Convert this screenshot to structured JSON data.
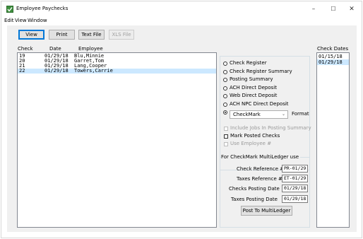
{
  "window": {
    "title": "Employee Paychecks",
    "controls": {
      "minimize": "–",
      "maximize": "☐",
      "close": "✕"
    }
  },
  "menu": [
    "Edit",
    "View",
    "Window"
  ],
  "toolbar": {
    "view": "View",
    "print": "Print",
    "text_file": "Text File",
    "xls_file": "XLS File"
  },
  "list_headers": {
    "check": "Check",
    "date": "Date",
    "employee": "Employee"
  },
  "checks": [
    {
      "check": "19",
      "date": "01/29/18",
      "employee": "Blu,Minnie"
    },
    {
      "check": "20",
      "date": "01/29/18",
      "employee": "Garret,Tom"
    },
    {
      "check": "21",
      "date": "01/29/18",
      "employee": "Lang,Cooper"
    },
    {
      "check": "22",
      "date": "01/29/18",
      "employee": "Towers,Carrie"
    }
  ],
  "options": {
    "check_register": "Check Register",
    "check_register_summary": "Check Register Summary",
    "posting_summary": "Posting Summary",
    "ach_direct_deposit": "ACH Direct Deposit",
    "web_direct_deposit": "Web Direct Deposit",
    "ach_npc_direct_deposit": "ACH NPC Direct Deposit",
    "format_select": "CheckMark",
    "format_label": "Format",
    "include_jobs": "Include Jobs In Posting Summary",
    "mark_posted": "Mark Posted Checks",
    "use_employee": "Use Employee #"
  },
  "multiledger": {
    "title": "For CheckMark MultiLedger use",
    "check_ref_label": "Check Reference #",
    "check_ref_value": "PR-01/29",
    "taxes_ref_label": "Taxes Reference #",
    "taxes_ref_value": "ET-01/29",
    "checks_date_label": "Checks Posting Date",
    "checks_date_value": "01/29/18",
    "taxes_date_label": "Taxes Posting Date",
    "taxes_date_value": "01/29/18",
    "post_button": "Post To MultiLedger"
  },
  "check_dates": {
    "header": "Check Dates",
    "items": [
      "01/15/18",
      "01/29/18"
    ]
  }
}
